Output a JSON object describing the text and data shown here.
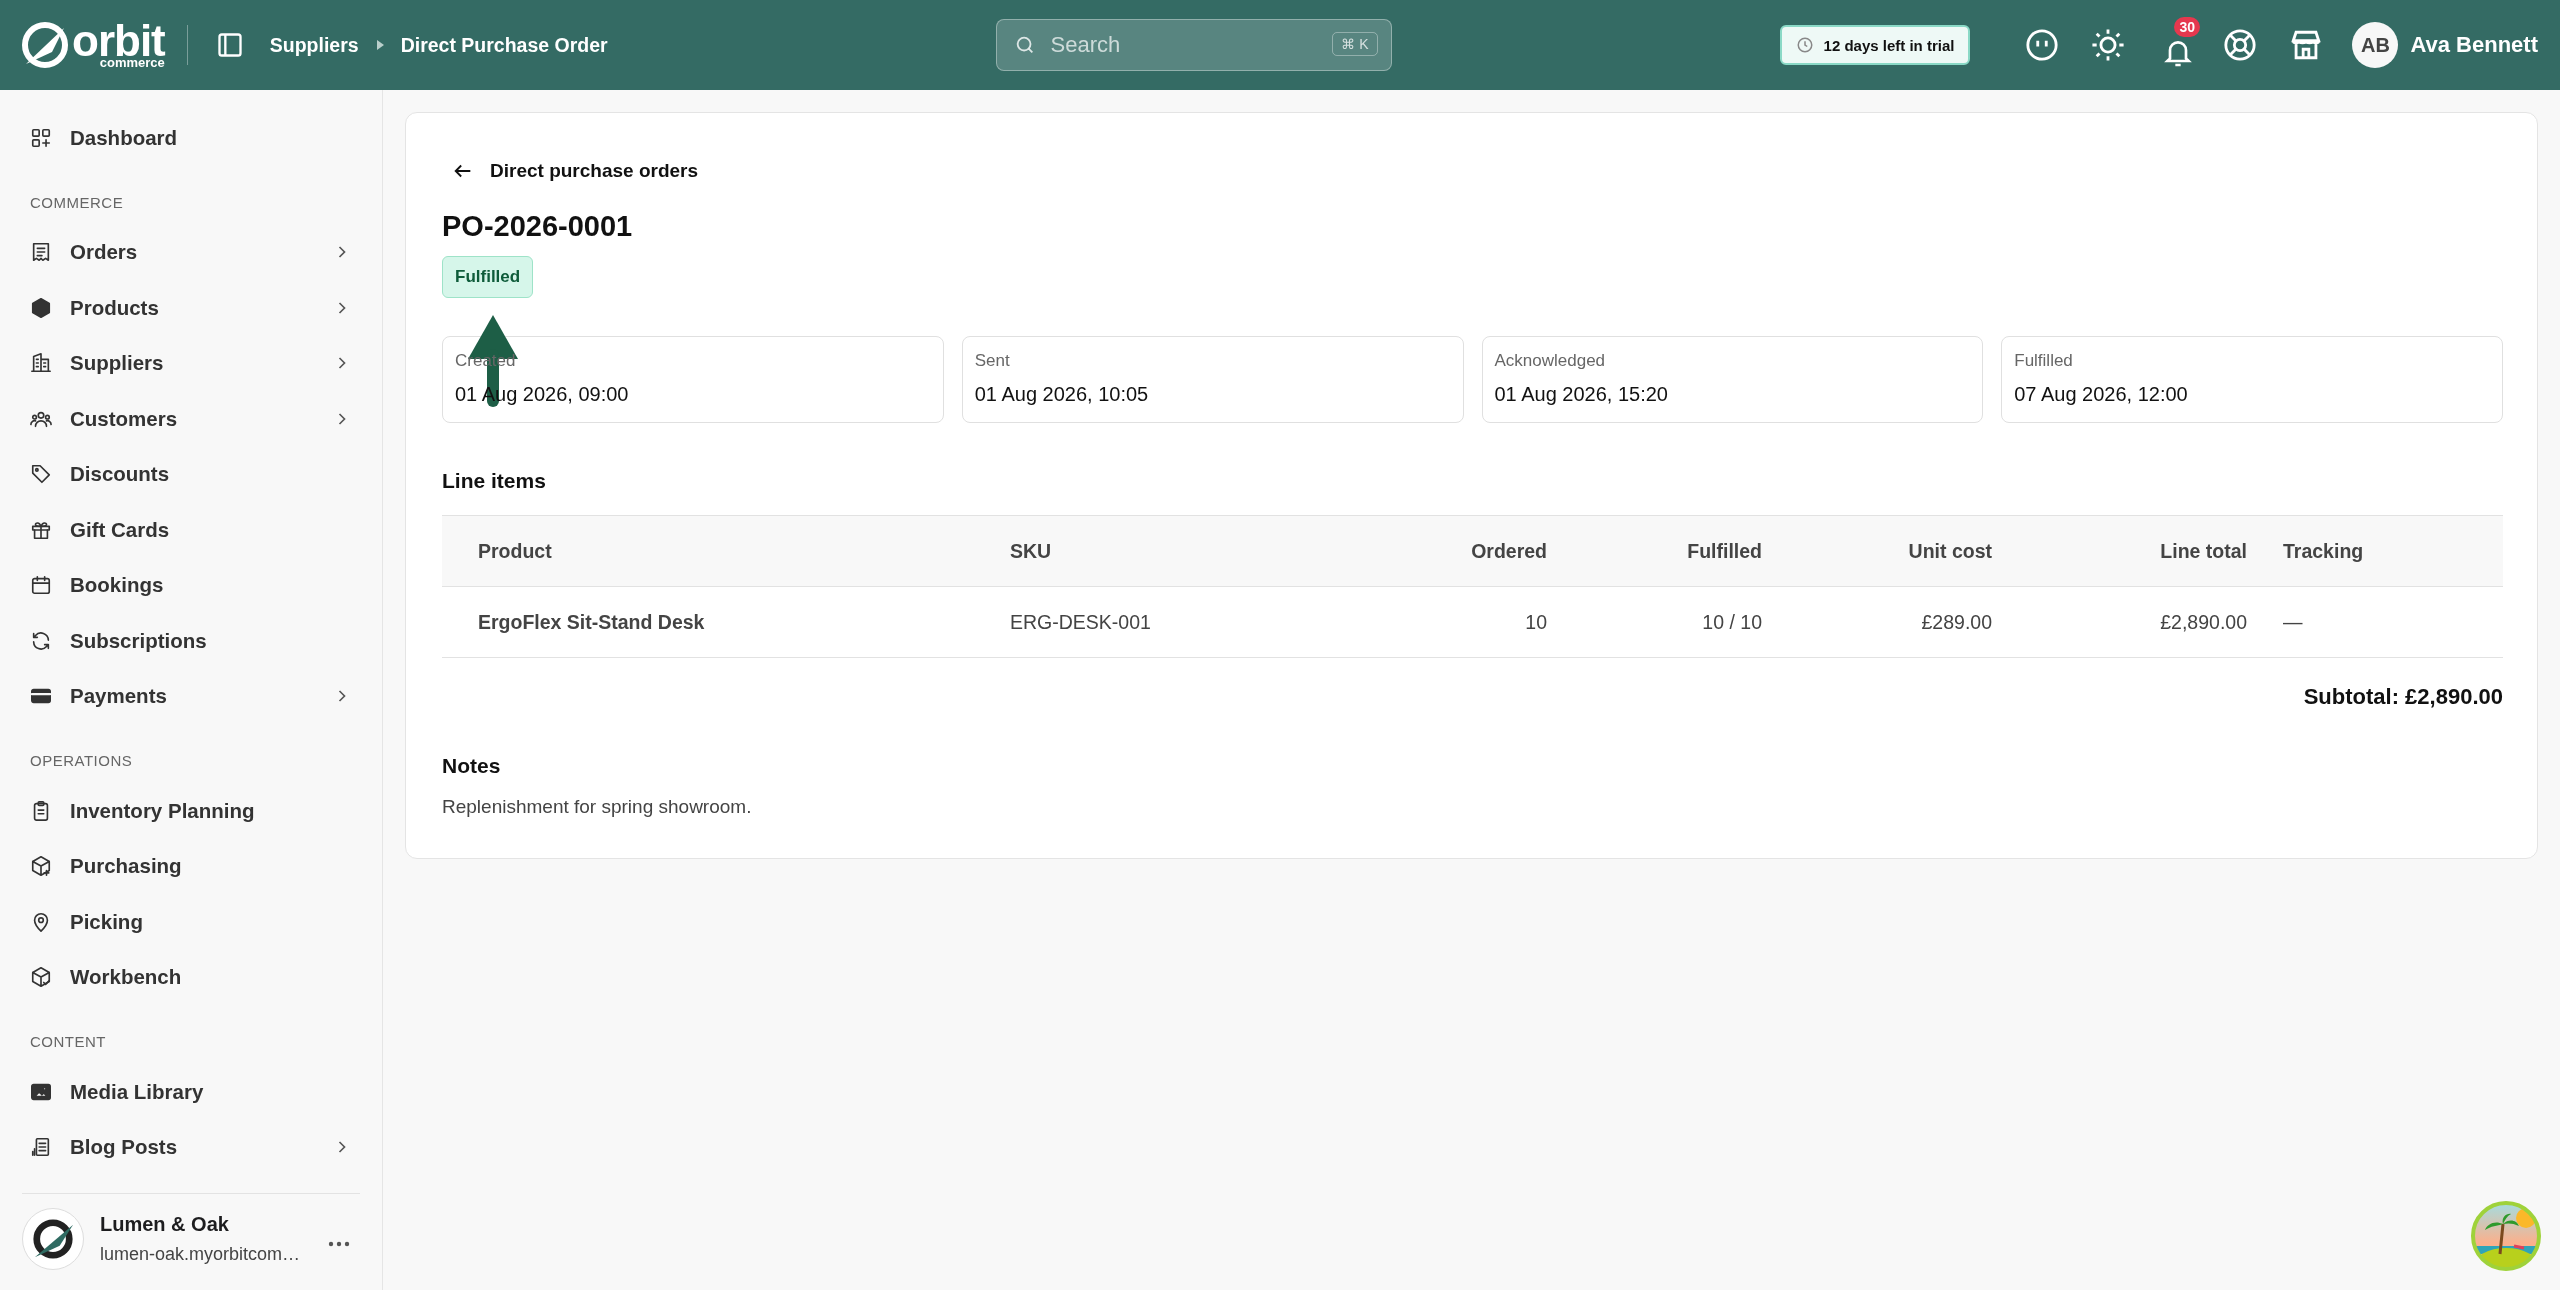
{
  "brand": {
    "name": "orbit",
    "sub": "commerce"
  },
  "breadcrumb": [
    {
      "label": "Suppliers"
    },
    {
      "label": "Direct Purchase Order"
    }
  ],
  "search": {
    "placeholder": "Search",
    "shortcut": "⌘ K"
  },
  "trial": "12 days left in trial",
  "notifications": "30",
  "user": {
    "initials": "AB",
    "name": "Ava Bennett"
  },
  "sidebar": [
    {
      "items": [
        {
          "label": "Dashboard",
          "expandable": false
        }
      ]
    },
    {
      "title": "COMMERCE",
      "items": [
        {
          "label": "Orders",
          "expandable": true
        },
        {
          "label": "Products",
          "expandable": true
        },
        {
          "label": "Suppliers",
          "expandable": true
        },
        {
          "label": "Customers",
          "expandable": true
        },
        {
          "label": "Discounts",
          "expandable": false
        },
        {
          "label": "Gift Cards",
          "expandable": false
        },
        {
          "label": "Bookings",
          "expandable": false
        },
        {
          "label": "Subscriptions",
          "expandable": false
        },
        {
          "label": "Payments",
          "expandable": true
        }
      ]
    },
    {
      "title": "OPERATIONS",
      "items": [
        {
          "label": "Inventory Planning",
          "expandable": false
        },
        {
          "label": "Purchasing",
          "expandable": false
        },
        {
          "label": "Picking",
          "expandable": false
        },
        {
          "label": "Workbench",
          "expandable": false
        }
      ]
    },
    {
      "title": "CONTENT",
      "items": [
        {
          "label": "Media Library",
          "expandable": false
        },
        {
          "label": "Blog Posts",
          "expandable": true
        }
      ]
    }
  ],
  "store": {
    "name": "Lumen & Oak",
    "domain": "lumen-oak.myorbitcom…"
  },
  "back_link": "Direct purchase orders",
  "order": {
    "number": "PO-2026-0001",
    "status": "Fulfilled"
  },
  "timeline": [
    {
      "label": "Created",
      "value": "01 Aug 2026, 09:00"
    },
    {
      "label": "Sent",
      "value": "01 Aug 2026, 10:05"
    },
    {
      "label": "Acknowledged",
      "value": "01 Aug 2026, 15:20"
    },
    {
      "label": "Fulfilled",
      "value": "07 Aug 2026, 12:00"
    }
  ],
  "line_items": {
    "title": "Line items",
    "columns": [
      "Product",
      "SKU",
      "Ordered",
      "Fulfilled",
      "Unit cost",
      "Line total",
      "Tracking"
    ],
    "rows": [
      [
        "ErgoFlex Sit-Stand Desk",
        "ERG-DESK-001",
        "10",
        "10 / 10",
        "£289.00",
        "£2,890.00",
        "—"
      ]
    ]
  },
  "subtotal": "Subtotal: £2,890.00",
  "notes": {
    "title": "Notes",
    "text": "Replenishment for spring showroom."
  }
}
